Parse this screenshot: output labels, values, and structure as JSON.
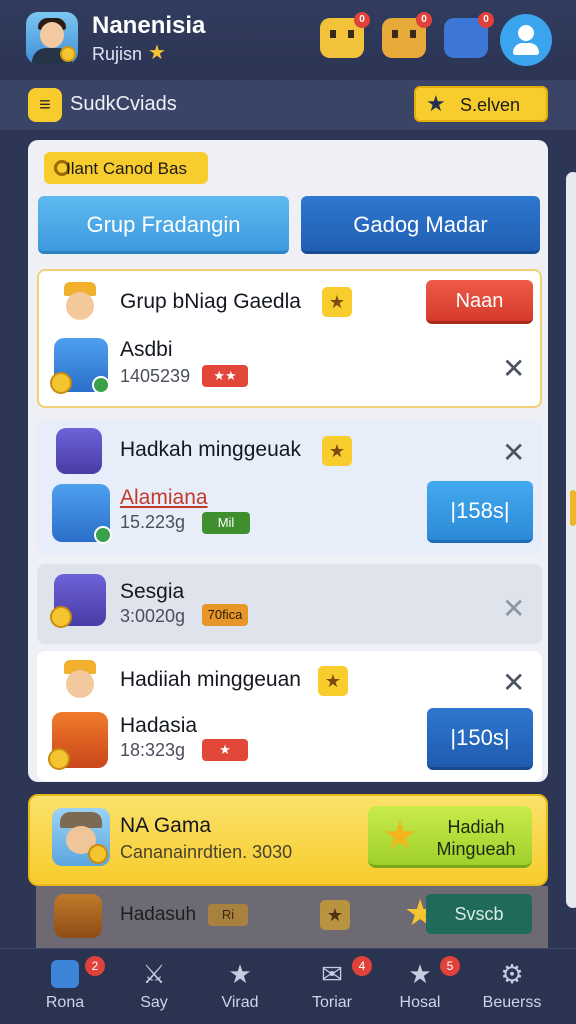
{
  "header": {
    "user_name": "Nanenisia",
    "user_sub": "Rujisn",
    "icons": [
      "gift-icon",
      "chest-icon",
      "shop-icon",
      "profile-icon"
    ],
    "icon_badges": [
      "0",
      "0",
      "0"
    ]
  },
  "subbar": {
    "title": "SudkCviads",
    "right_button": "S.elven"
  },
  "panel": {
    "tag": "Ilant Canod Bas",
    "tabs": [
      "Grup Fradangin",
      "Gadog Madar"
    ]
  },
  "cards": [
    {
      "title": "Grup bNiag Gaedla",
      "action": "Naan",
      "item_name": "Asdbi",
      "item_value": "1405239",
      "chip": "★★"
    },
    {
      "title": "Hadkah minggeuak",
      "item_name": "Alamiana",
      "item_value": "15.223g",
      "chip": "Mil",
      "action": "|158s|"
    },
    {
      "item_name": "Sesgia",
      "item_value": "3:0020g",
      "chip": "70fica"
    },
    {
      "title": "Hadiiah minggeuan",
      "item_name": "Hadasia",
      "item_value": "18:323g",
      "chip": "★",
      "action": "|150s|"
    }
  ],
  "featured": {
    "name": "NA Gama",
    "sub": "Cananainrdtien. 3030",
    "button": "Hadiah Mingueah"
  },
  "partial": {
    "name": "Hadasuh",
    "chip": "Ri",
    "button": "Svscb"
  },
  "nav": [
    {
      "label": "Rona",
      "badge": "2"
    },
    {
      "label": "Say"
    },
    {
      "label": "Virad"
    },
    {
      "label": "Toriar",
      "badge": "4"
    },
    {
      "label": "Hosal",
      "badge": "5"
    },
    {
      "label": "Beuerss"
    }
  ],
  "colors": {
    "accent_yellow": "#f7cc2c",
    "accent_blue": "#2e77d0",
    "accent_red": "#e2483a",
    "background": "#2d3655"
  }
}
